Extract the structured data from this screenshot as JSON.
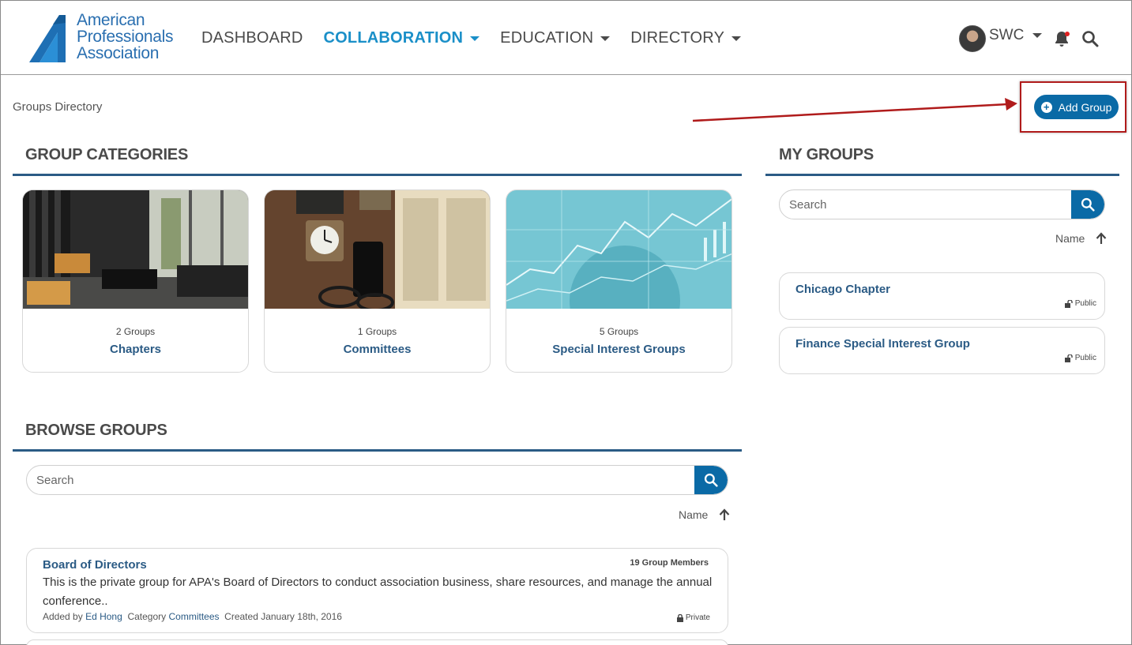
{
  "brand": {
    "logo_lines": [
      "American",
      "Professionals",
      "Association"
    ],
    "primary_color": "#0a6aa6",
    "heading_color": "#2b5b85",
    "active_nav_color": "#1a8fc8"
  },
  "nav": {
    "items": [
      {
        "label": "DASHBOARD",
        "dropdown": false,
        "active": false
      },
      {
        "label": "COLLABORATION",
        "dropdown": true,
        "active": true
      },
      {
        "label": "EDUCATION",
        "dropdown": true,
        "active": false
      },
      {
        "label": "DIRECTORY",
        "dropdown": true,
        "active": false
      }
    ]
  },
  "user": {
    "initials": "SWC",
    "has_notification": true
  },
  "breadcrumb": "Groups Directory",
  "add_group_label": "Add Group",
  "group_categories": {
    "title": "GROUP CATEGORIES",
    "items": [
      {
        "count": "2 Groups",
        "name": "Chapters",
        "image": "lobby-photo"
      },
      {
        "count": "1 Groups",
        "name": "Committees",
        "image": "desk-clock-photo"
      },
      {
        "count": "5 Groups",
        "name": "Special Interest Groups",
        "image": "finance-chart-photo"
      }
    ]
  },
  "my_groups": {
    "title": "MY GROUPS",
    "search_placeholder": "Search",
    "sort_label": "Name",
    "items": [
      {
        "name": "Chicago Chapter",
        "visibility": "Public"
      },
      {
        "name": "Finance Special Interest Group",
        "visibility": "Public"
      }
    ]
  },
  "browse_groups": {
    "title": "BROWSE GROUPS",
    "search_placeholder": "Search",
    "sort_label": "Name",
    "items": [
      {
        "name": "Board of Directors",
        "members": "19 Group Members",
        "description": "This is the private group for APA's Board of Directors to conduct association business, share resources, and manage the annual conference..",
        "added_by_label": "Added by",
        "added_by": "Ed Hong",
        "category_label": "Category",
        "category": "Committees",
        "created": "Created January 18th, 2016",
        "visibility": "Private"
      }
    ]
  }
}
